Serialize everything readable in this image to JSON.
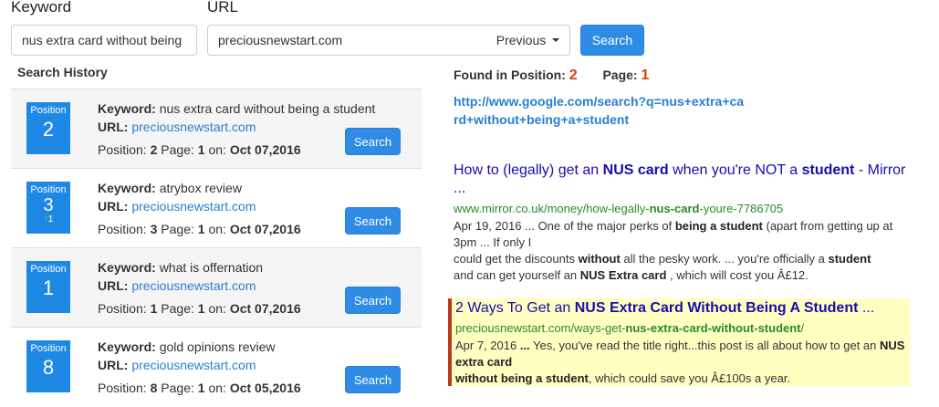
{
  "form": {
    "keyword_label": "Keyword",
    "url_label": "URL",
    "keyword_value": "nus extra card without being",
    "url_value": "preciousnewstart.com",
    "previous_label": "Previous",
    "search_label": "Search"
  },
  "history": {
    "title": "Search History",
    "keyword_prefix": "Keyword:",
    "url_prefix": "URL:",
    "position_prefix": "Position:",
    "page_prefix": "Page:",
    "on_prefix": "on:",
    "button_label": "Search",
    "badge_label": "Position",
    "rows": [
      {
        "position": "2",
        "change": "",
        "keyword": "nus extra card without being a student",
        "url": "preciousnewstart.com",
        "page": "1",
        "date": "Oct 07,2016"
      },
      {
        "position": "3",
        "change": "1",
        "keyword": "atrybox review",
        "url": "preciousnewstart.com",
        "page": "1",
        "date": "Oct 07,2016"
      },
      {
        "position": "1",
        "change": "",
        "keyword": "what is offernation",
        "url": "preciousnewstart.com",
        "page": "1",
        "date": "Oct 07,2016"
      },
      {
        "position": "8",
        "change": "",
        "keyword": "gold opinions review",
        "url": "preciousnewstart.com",
        "page": "1",
        "date": "Oct 05,2016"
      }
    ]
  },
  "found": {
    "position_label": "Found in Position:",
    "position_value": "2",
    "page_label": "Page:",
    "page_value": "1",
    "google_link": "http://www.google.com/search?q=nus+extra+card+without+being+a+student"
  },
  "results": [
    {
      "title_a": "How to (legally) get an ",
      "title_b": "NUS card",
      "title_c": " when you're NOT a ",
      "title_d": "student",
      "title_e": " - Mirror ...",
      "url_a": "www.mirror.co.uk/money/how-legally-",
      "url_b": "nus-card",
      "url_c": "-youre-7786705",
      "s1": "Apr 19, 2016 ... One of the major perks of ",
      "s2": "being a student",
      "s3": " (apart from getting up at 3pm ... If only I",
      "s4": "could get the discounts ",
      "s5": "without",
      "s6": " all the pesky work. ... you're officially a ",
      "s7": "student",
      "s8": "and can get yourself an ",
      "s9": "NUS Extra card",
      "s10": " , which will cost you Â£12."
    },
    {
      "title_a": "2 Ways To Get an ",
      "title_b": "NUS Extra Card",
      "title_c": "  ",
      "title_d": "Without Being A Student",
      "title_e": " ...",
      "url_a": "preciousnewstart.com/ways-get-",
      "url_b": "nus-extra-card-without-student",
      "url_c": "/",
      "s1": "Apr 7, 2016 ",
      "s2": "...",
      "s3": " Yes, you've read the title right...this post is all about how to get an ",
      "s4": "NUS extra card",
      "s5": "without being a student",
      "s6": ", which could save you Â£100s a year."
    }
  ]
}
